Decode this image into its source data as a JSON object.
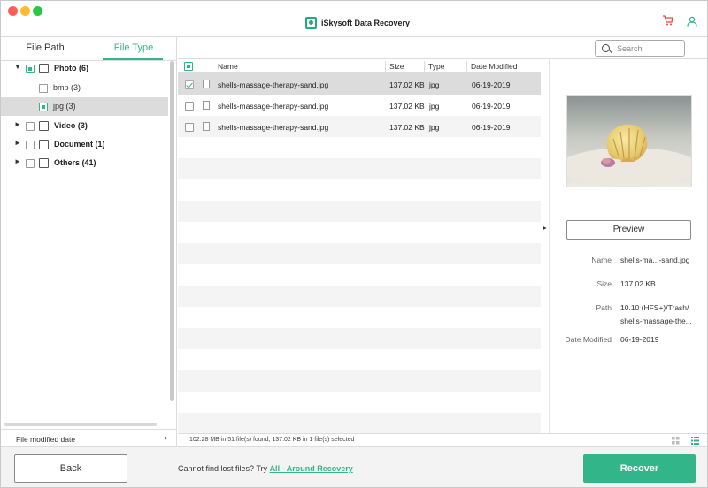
{
  "app": {
    "title": "iSkysoft Data Recovery"
  },
  "colors": {
    "accent": "#33b58a",
    "cart": "#e5483a"
  },
  "tabs": {
    "file_path": "File Path",
    "file_type": "File Type"
  },
  "search": {
    "placeholder": "Search"
  },
  "tree": [
    {
      "label": "Photo (6)",
      "icon": "photo-icon",
      "checked": "partial",
      "expanded": true
    },
    {
      "label": "bmp (3)",
      "checked": false
    },
    {
      "label": "jpg (3)",
      "checked": "partial",
      "selected": true
    },
    {
      "label": "Video (3)",
      "icon": "video-icon",
      "checked": false
    },
    {
      "label": "Document (1)",
      "icon": "document-icon",
      "checked": false
    },
    {
      "label": "Others (41)",
      "icon": "others-icon",
      "checked": false
    }
  ],
  "left_footer": {
    "label": "File modified date"
  },
  "table": {
    "headers": {
      "name": "Name",
      "size": "Size",
      "type": "Type",
      "date": "Date Modified"
    },
    "rows": [
      {
        "name": "shells-massage-therapy-sand.jpg",
        "size": "137.02 KB",
        "type": "jpg",
        "date": "06-19-2019",
        "checked": true
      },
      {
        "name": "shells-massage-therapy-sand.jpg",
        "size": "137.02 KB",
        "type": "jpg",
        "date": "06-19-2019",
        "checked": false
      },
      {
        "name": "shells-massage-therapy-sand.jpg",
        "size": "137.02 KB",
        "type": "jpg",
        "date": "06-19-2019",
        "checked": false
      }
    ]
  },
  "preview": {
    "button": "Preview",
    "labels": {
      "name": "Name",
      "size": "Size",
      "path": "Path",
      "date": "Date Modified"
    },
    "name": "shells-ma...-sand.jpg",
    "size": "137.02 KB",
    "path_line1": "10.10 (HFS+)/Trash/",
    "path_line2": "shells-massage-the...",
    "date": "06-19-2019"
  },
  "status": {
    "text": "102.28 MB in 51 file(s) found, 137.02 KB in 1 file(s) selected"
  },
  "bottom": {
    "back": "Back",
    "hint": "Cannot find lost files? Try ",
    "hint_link": "All - Around Recovery",
    "recover": "Recover"
  }
}
